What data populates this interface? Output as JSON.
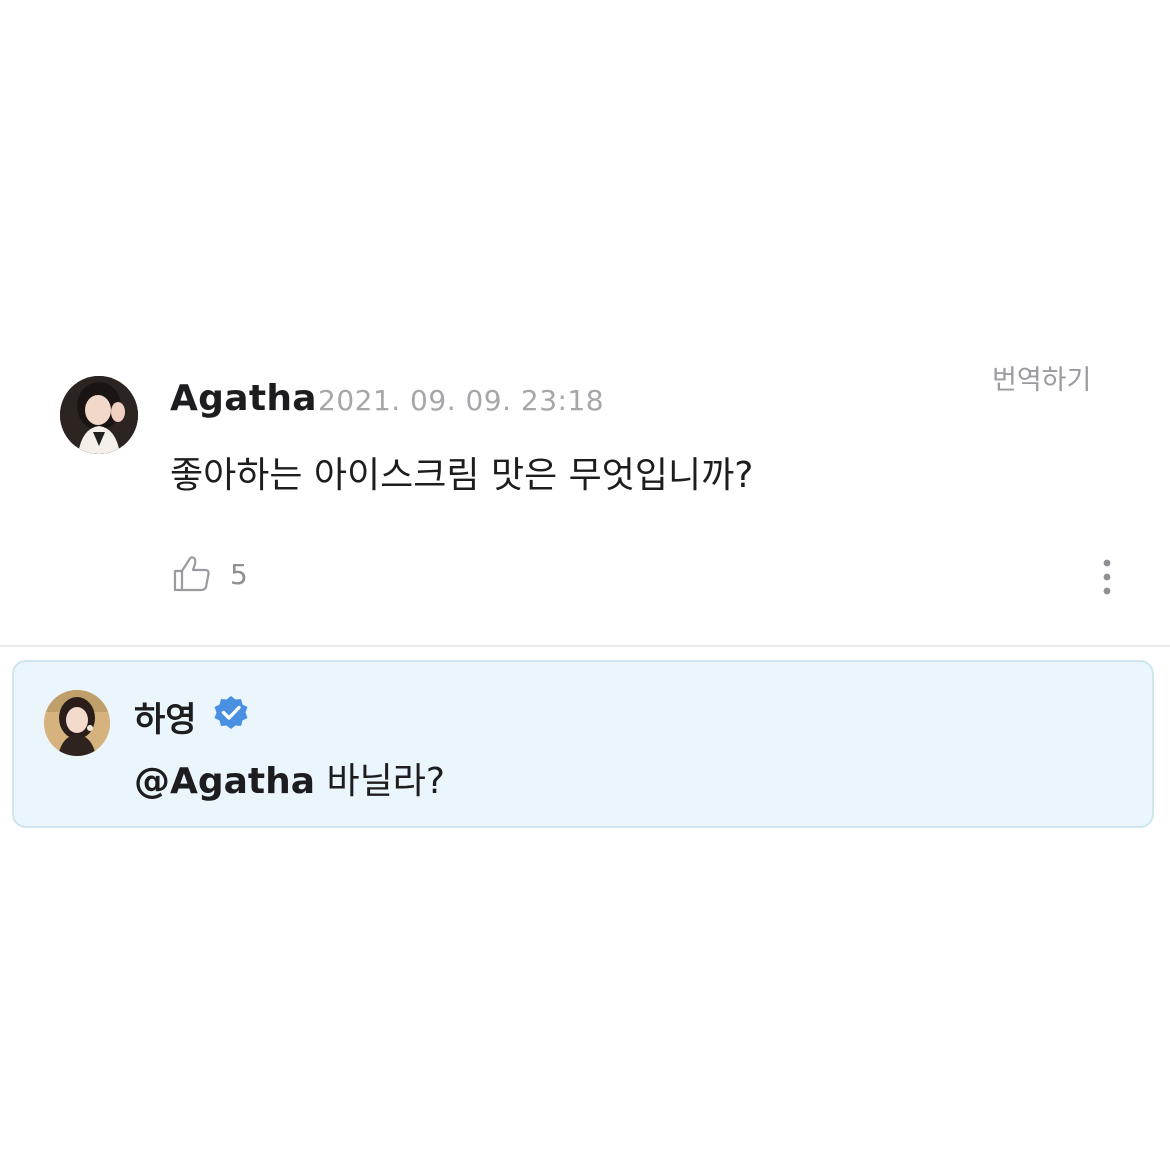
{
  "comment": {
    "author": "Agatha",
    "timestamp": "2021. 09. 09. 23:18",
    "translate_label": "번역하기",
    "text": "좋아하는 아이스크림 맛은 무엇입니까?",
    "like_count": "5",
    "like_icon": "thumbs-up-icon",
    "more_icon": "more-vertical-icon"
  },
  "reply": {
    "author": "하영",
    "verified_icon": "verified-badge-icon",
    "mention": "@Agatha",
    "text": "바닐라?"
  },
  "colors": {
    "reply_background": "#eaf6fc",
    "reply_border": "#cfe5ef",
    "verified_badge": "#4a90e2",
    "timestamp": "#a6a6ab"
  }
}
